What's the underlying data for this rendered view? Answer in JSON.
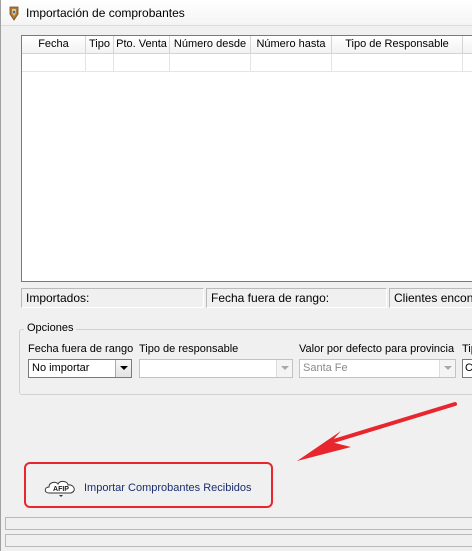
{
  "window": {
    "title": "Importación de comprobantes"
  },
  "grid": {
    "columns": [
      "Fecha",
      "Tipo",
      "Pto. Venta",
      "Número desde",
      "Número hasta",
      "Tipo de Responsable"
    ],
    "rows": [
      [
        "",
        "",
        "",
        "",
        "",
        ""
      ]
    ]
  },
  "status": {
    "importados": "Importados:",
    "fecha_fuera_rango": "Fecha fuera de rango:",
    "clientes": "Clientes encont"
  },
  "options": {
    "legend": "Opciones",
    "fecha_label": "Fecha fuera de rango",
    "fecha_value": "No importar",
    "responsable_label": "Tipo de responsable",
    "responsable_value": "",
    "provincia_label": "Valor por defecto para provincia",
    "provincia_value": "Santa Fe",
    "extra_label": "Tip",
    "extra_value": "Co"
  },
  "afip": {
    "logo_text": "AFIP",
    "button_label": "Importar Comprobantes Recibidos"
  },
  "colors": {
    "highlight": "#e8262d",
    "link": "#1a2e6e"
  }
}
